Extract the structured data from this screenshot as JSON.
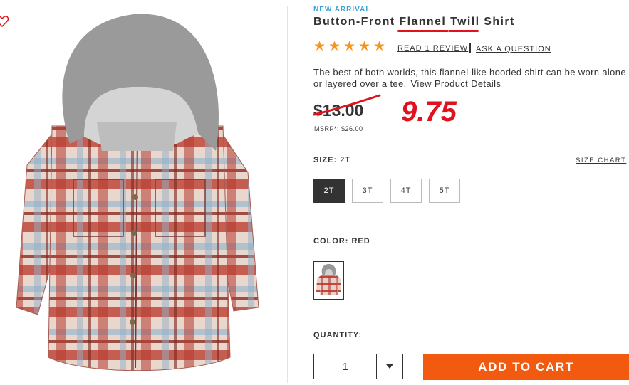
{
  "product": {
    "badge": "NEW ARRIVAL",
    "title_pre": "Button-Front ",
    "title_hl1": "Flannel",
    "title_mid": " ",
    "title_hl2": "Twil",
    "title_post": "l Shirt",
    "rating": 5,
    "review_link": "READ 1 REVIEW",
    "question_link": "ASK A QUESTION",
    "description": "The best of both worlds, this flannel-like hooded shirt can be worn alone or layered over a tee.",
    "details_link": "View Product Details",
    "old_price": "$13.00",
    "new_price_annotation": "9.75",
    "msrp": "MSRP*: $26.00"
  },
  "size": {
    "label": "SIZE:",
    "selected": "2T",
    "chart_link": "SIZE CHART",
    "options": [
      "2T",
      "3T",
      "4T",
      "5T"
    ]
  },
  "color": {
    "label": "COLOR: RED"
  },
  "quantity": {
    "label": "QUANTITY:",
    "value": "1"
  },
  "cart": {
    "button": "ADD TO CART"
  },
  "colors": {
    "accent_blue": "#3aa1d6",
    "star": "#f7941d",
    "annotation_red": "#e0121d",
    "cart_orange": "#f15a0f"
  }
}
